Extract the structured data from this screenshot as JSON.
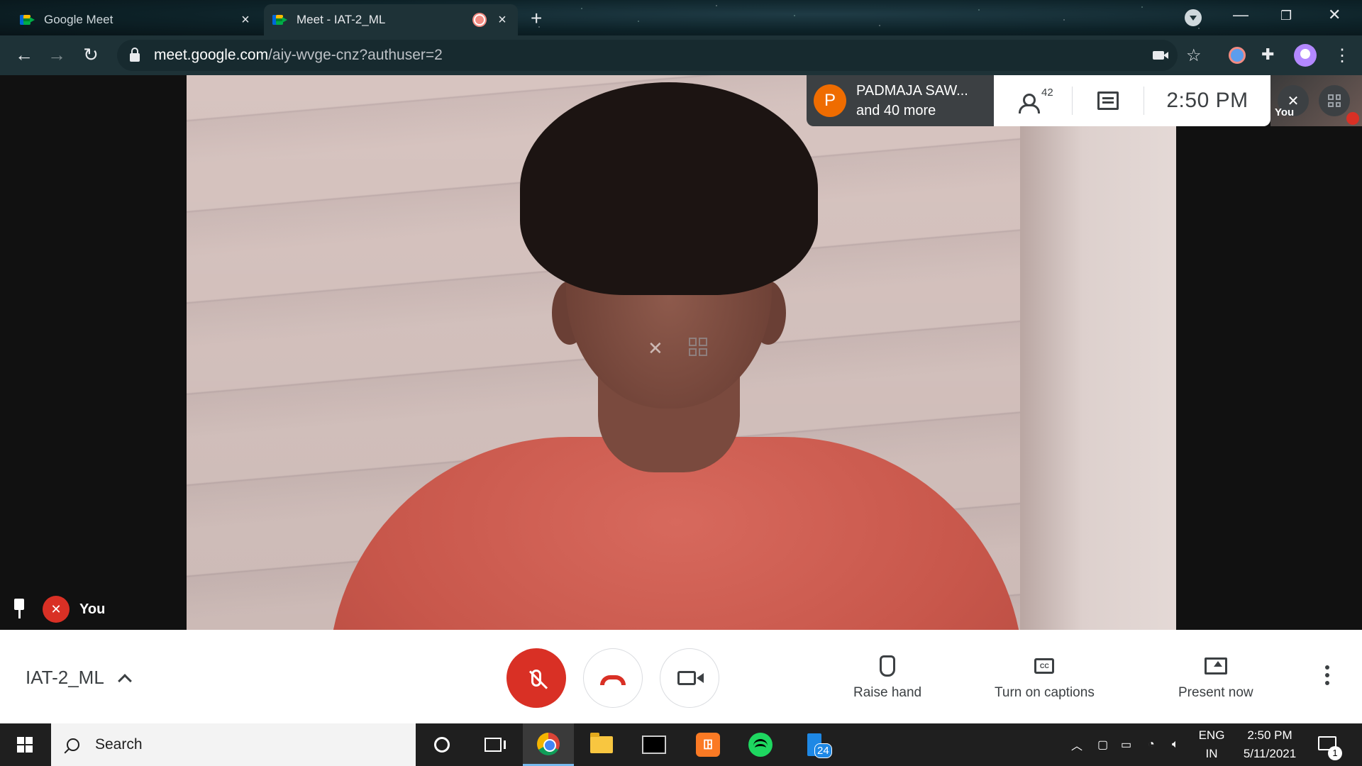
{
  "browser": {
    "tabs": [
      {
        "title": "Google Meet",
        "active": false
      },
      {
        "title": "Meet - IAT-2_ML",
        "active": true,
        "recording": true
      }
    ],
    "url_host": "meet.google.com",
    "url_path": "/aiy-wvge-cnz?authuser=2"
  },
  "meet": {
    "presenter": {
      "initial": "P",
      "name": "PADMAJA SAW...",
      "more": "and 40 more"
    },
    "people_count": "42",
    "time": "2:50  PM",
    "self_label": "You",
    "tile_label": "You",
    "meeting_name": "IAT-2_ML",
    "actions": {
      "raise_hand": "Raise hand",
      "captions": "Turn on captions",
      "captions_icon": "CC",
      "present": "Present now"
    },
    "colors": {
      "mute_red": "#d93025",
      "avatar_orange": "#ef6c00"
    }
  },
  "taskbar": {
    "search_placeholder": "Search",
    "badge": "24",
    "xampp_glyph": "ꖸ",
    "lang_line1": "ENG",
    "lang_line2": "IN",
    "clock_time": "2:50 PM",
    "clock_date": "5/11/2021",
    "notifications": "1"
  }
}
